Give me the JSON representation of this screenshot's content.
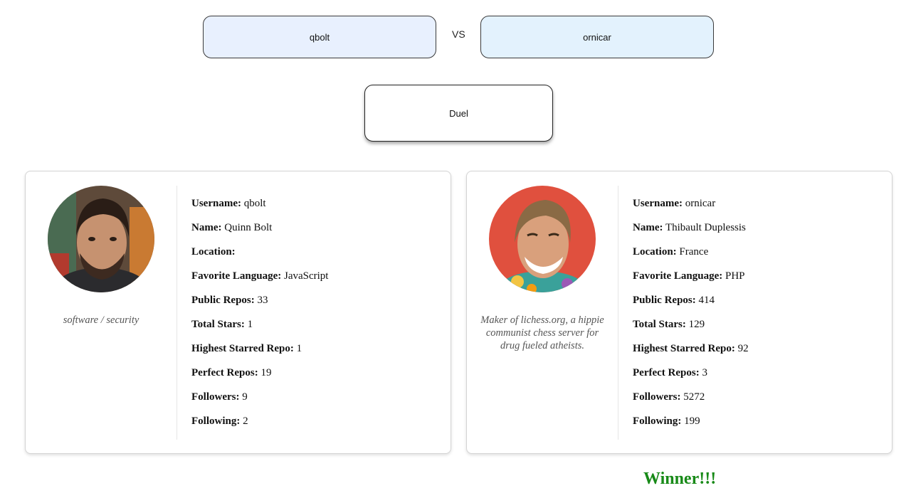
{
  "inputs": {
    "left_value": "qbolt",
    "right_value": "ornicar",
    "vs_label": "VS"
  },
  "duel_button_label": "Duel",
  "colors": {
    "left_input_bg": "#e8f0fe",
    "right_input_bg": "#e3f2fd",
    "winner_text": "#188a18"
  },
  "cards": [
    {
      "bio": "software / security",
      "stats": [
        {
          "label": "Username:",
          "value": "qbolt"
        },
        {
          "label": "Name:",
          "value": "Quinn Bolt"
        },
        {
          "label": "Location:",
          "value": ""
        },
        {
          "label": "Favorite Language:",
          "value": "JavaScript"
        },
        {
          "label": "Public Repos:",
          "value": "33"
        },
        {
          "label": "Total Stars:",
          "value": "1"
        },
        {
          "label": "Highest Starred Repo:",
          "value": "1"
        },
        {
          "label": "Perfect Repos:",
          "value": "19"
        },
        {
          "label": "Followers:",
          "value": "9"
        },
        {
          "label": "Following:",
          "value": "2"
        }
      ]
    },
    {
      "bio": "Maker of lichess.org, a hippie communist chess server for drug fueled atheists.",
      "stats": [
        {
          "label": "Username:",
          "value": "ornicar"
        },
        {
          "label": "Name:",
          "value": "Thibault Duplessis"
        },
        {
          "label": "Location:",
          "value": "France"
        },
        {
          "label": "Favorite Language:",
          "value": "PHP"
        },
        {
          "label": "Public Repos:",
          "value": "414"
        },
        {
          "label": "Total Stars:",
          "value": "129"
        },
        {
          "label": "Highest Starred Repo:",
          "value": "92"
        },
        {
          "label": "Perfect Repos:",
          "value": "3"
        },
        {
          "label": "Followers:",
          "value": "5272"
        },
        {
          "label": "Following:",
          "value": "199"
        }
      ]
    }
  ],
  "winner_text": "Winner!!!"
}
